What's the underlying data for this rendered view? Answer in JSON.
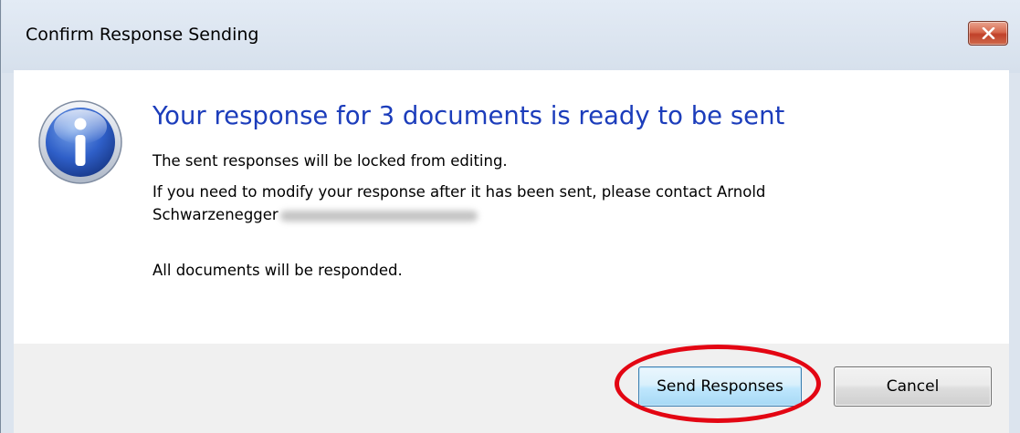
{
  "window": {
    "title": "Confirm Response Sending",
    "close_icon": "close-x-icon"
  },
  "dialog": {
    "icon": "information-icon",
    "heading": "Your response for 3 documents is ready to be sent",
    "line1": "The sent responses will be locked from editing.",
    "line2": "If you need to modify your response after it has been sent, please contact Arnold",
    "line3": "Schwarzenegger",
    "line4": "All documents will be responded."
  },
  "buttons": {
    "send_label": "Send Responses",
    "cancel_label": "Cancel"
  },
  "colors": {
    "heading": "#1c3dbb",
    "highlight": "#e30613",
    "close_button": "#c1412a"
  }
}
